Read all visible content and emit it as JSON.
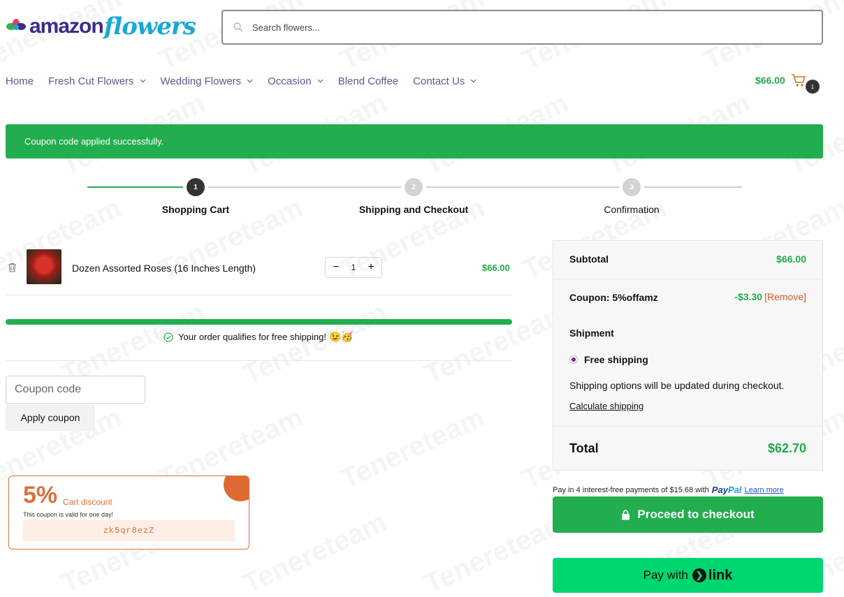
{
  "header": {
    "logo_amazon": "amazon",
    "logo_flowers": "flowers",
    "search_placeholder": "Search flowers..."
  },
  "nav": [
    {
      "label": "Home",
      "has_dropdown": false
    },
    {
      "label": "Fresh Cut Flowers",
      "has_dropdown": true
    },
    {
      "label": "Wedding Flowers",
      "has_dropdown": true
    },
    {
      "label": "Occasion",
      "has_dropdown": true
    },
    {
      "label": "Blend Coffee",
      "has_dropdown": false
    },
    {
      "label": "Contact Us",
      "has_dropdown": true
    }
  ],
  "mini_cart": {
    "total": "$66.00",
    "count": "1"
  },
  "notice": "Coupon code applied successfully.",
  "steps": [
    {
      "number": "1",
      "label": "Shopping Cart"
    },
    {
      "number": "2",
      "label": "Shipping and Checkout"
    },
    {
      "number": "3",
      "label": "Confirmation"
    }
  ],
  "cart_item": {
    "name": "Dozen Assorted Roses (16 Inches Length)",
    "quantity": "1",
    "minus": "−",
    "plus": "+",
    "price": "$66.00"
  },
  "free_shipping": {
    "message": "Your order qualifies for free shipping!",
    "emoji": "😉🥳",
    "progress": 1.0
  },
  "coupon": {
    "placeholder": "Coupon code",
    "apply_label": "Apply coupon"
  },
  "promo": {
    "percent": "5%",
    "label": "Cart discount",
    "note": "This coupon is valid for one day!",
    "code": "zk5qr8ezZ"
  },
  "totals": {
    "subtotal_label": "Subtotal",
    "subtotal_value": "$66.00",
    "coupon_label": "Coupon: 5%offamz",
    "coupon_value": "-$3.30",
    "remove_label": "[Remove]",
    "shipment_label": "Shipment",
    "shipping_option": "Free shipping",
    "shipping_note": "Shipping options will be updated during checkout.",
    "calculate_label": "Calculate shipping",
    "total_label": "Total",
    "total_value": "$62.70"
  },
  "paypal": {
    "text": "Pay in 4 interest-free payments of $15.68 with",
    "brand_1": "Pay",
    "brand_2": "Pal",
    "learn_more": "Learn more"
  },
  "checkout_label": "Proceed to checkout",
  "link_pay": {
    "prefix": "Pay with",
    "brand": "link"
  },
  "watermark": "Tenereteam",
  "colors": {
    "accent": "#22ae4e",
    "promo": "#d8703a",
    "nav": "#5b5a8e",
    "link_green": "#00d66f"
  }
}
